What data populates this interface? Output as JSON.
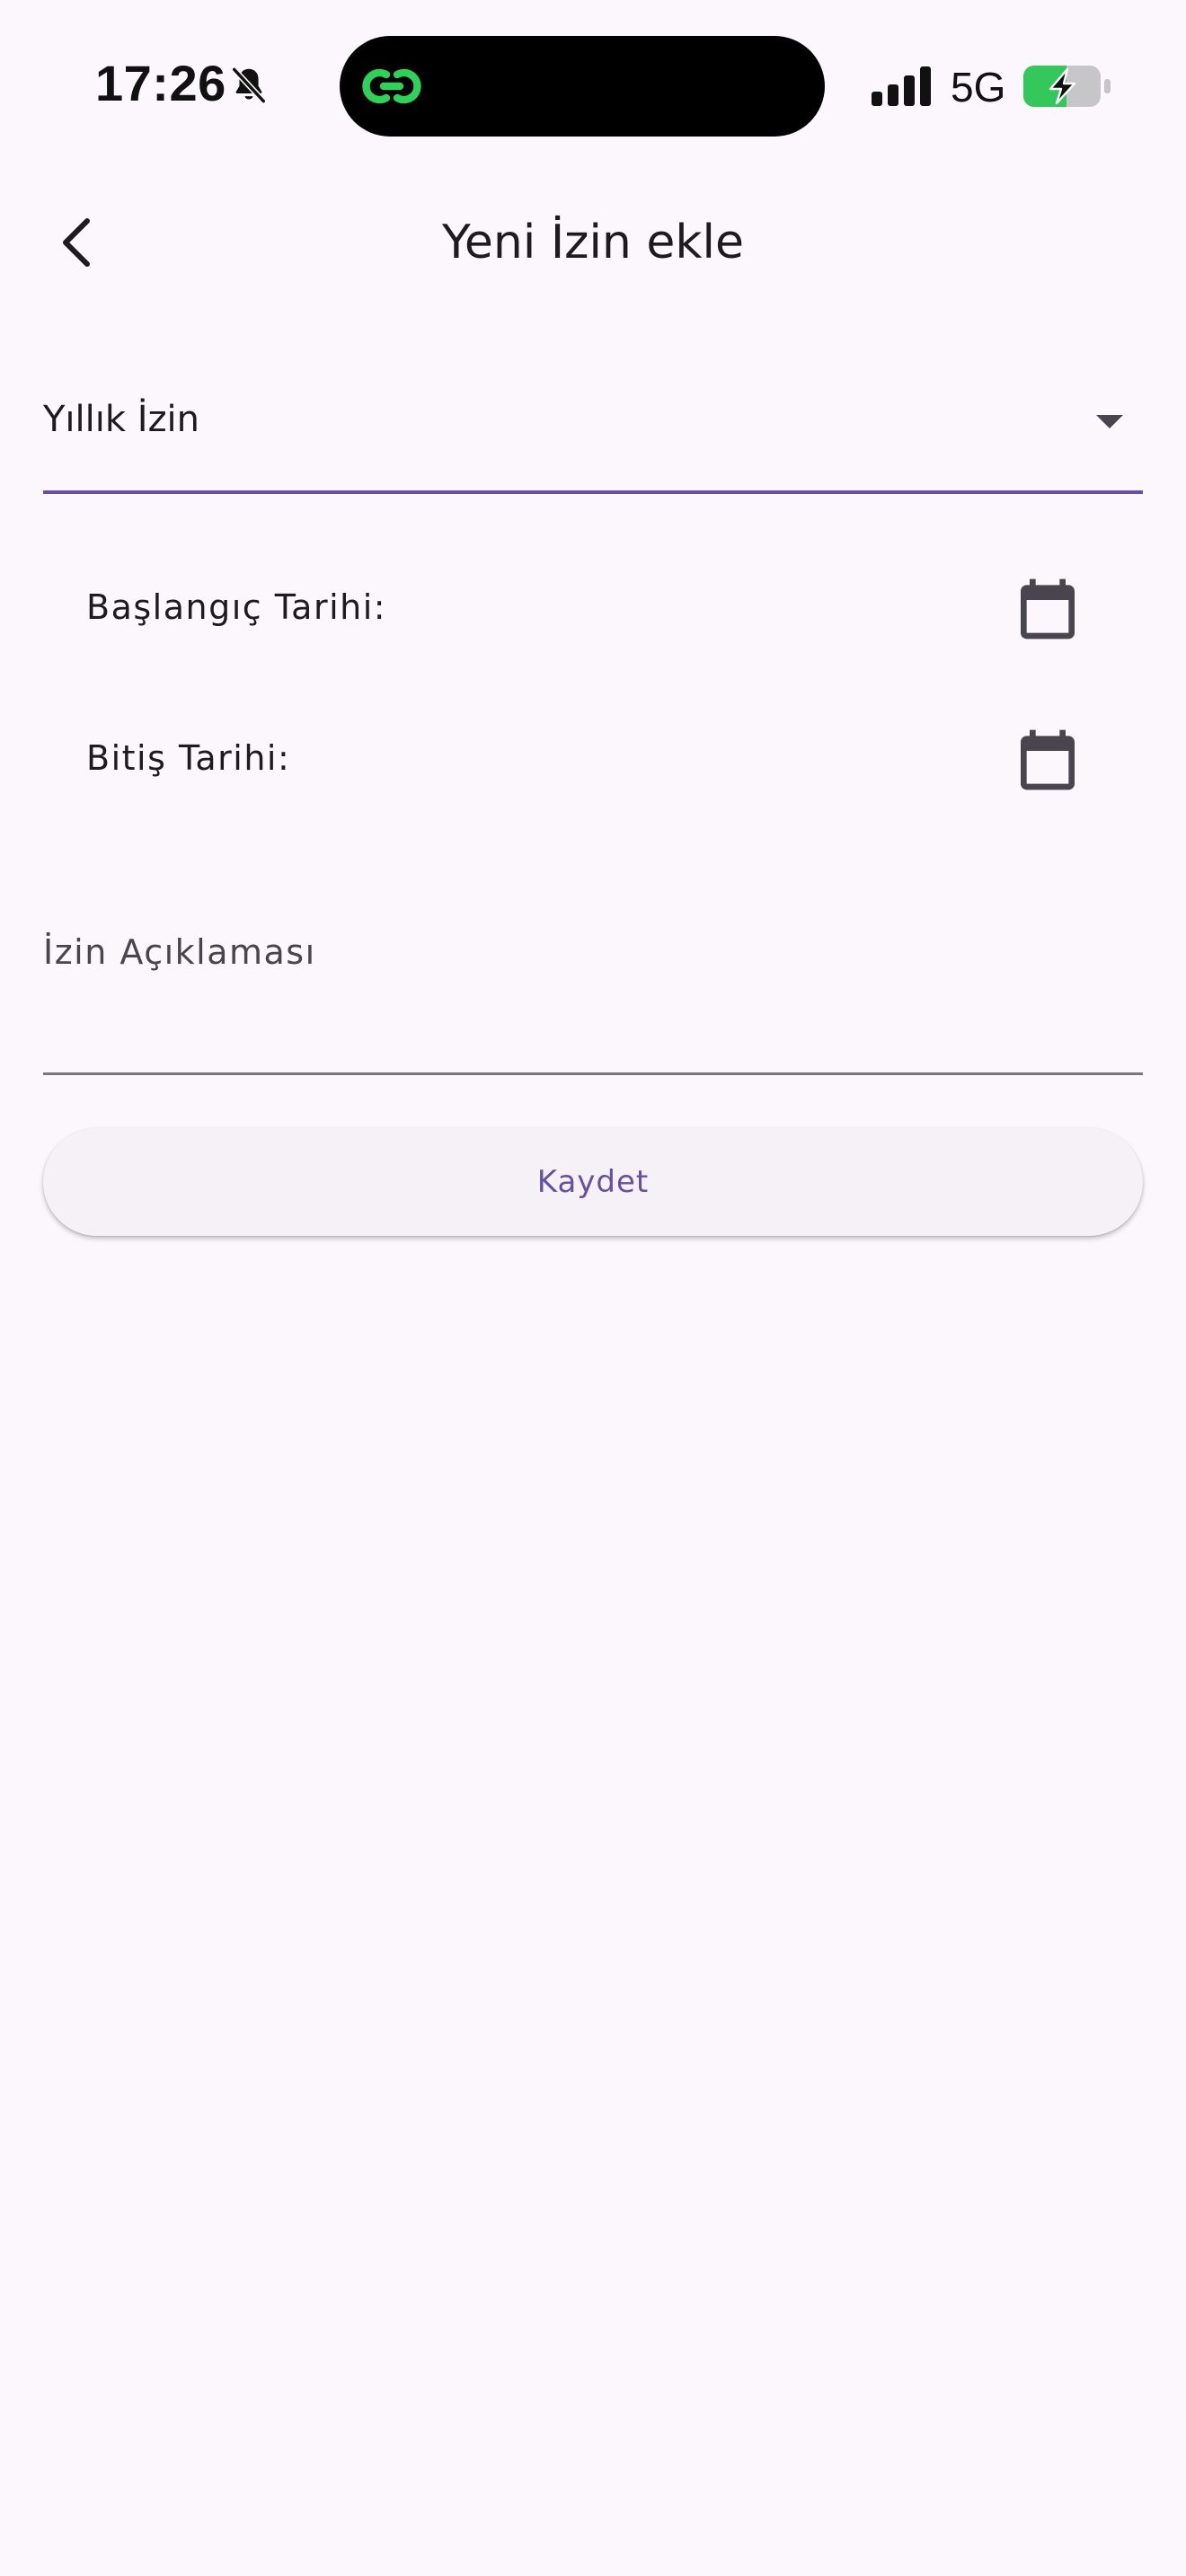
{
  "status_bar": {
    "time": "17:26",
    "network": "5G",
    "icons": [
      "bell-slash-icon",
      "link-icon",
      "cellular-signal-icon",
      "battery-charging-icon"
    ]
  },
  "app_bar": {
    "back_icon": "chevron-left-icon",
    "title": "Yeni İzin ekle"
  },
  "form": {
    "leave_type": {
      "selected": "Yıllık İzin",
      "icon": "dropdown-arrow-icon"
    },
    "start_date": {
      "label": "Başlangıç Tarihi:",
      "icon": "calendar-icon"
    },
    "end_date": {
      "label": "Bitiş Tarihi:",
      "icon": "calendar-icon"
    },
    "description": {
      "label": "İzin Açıklaması",
      "value": ""
    },
    "save_label": "Kaydet"
  },
  "colors": {
    "background": "#fcf7fc",
    "primary": "#6750a4",
    "button_surface": "#f5f1f7",
    "text": "#1d1b20",
    "battery_green": "#34c759",
    "link_green": "#30d158"
  }
}
